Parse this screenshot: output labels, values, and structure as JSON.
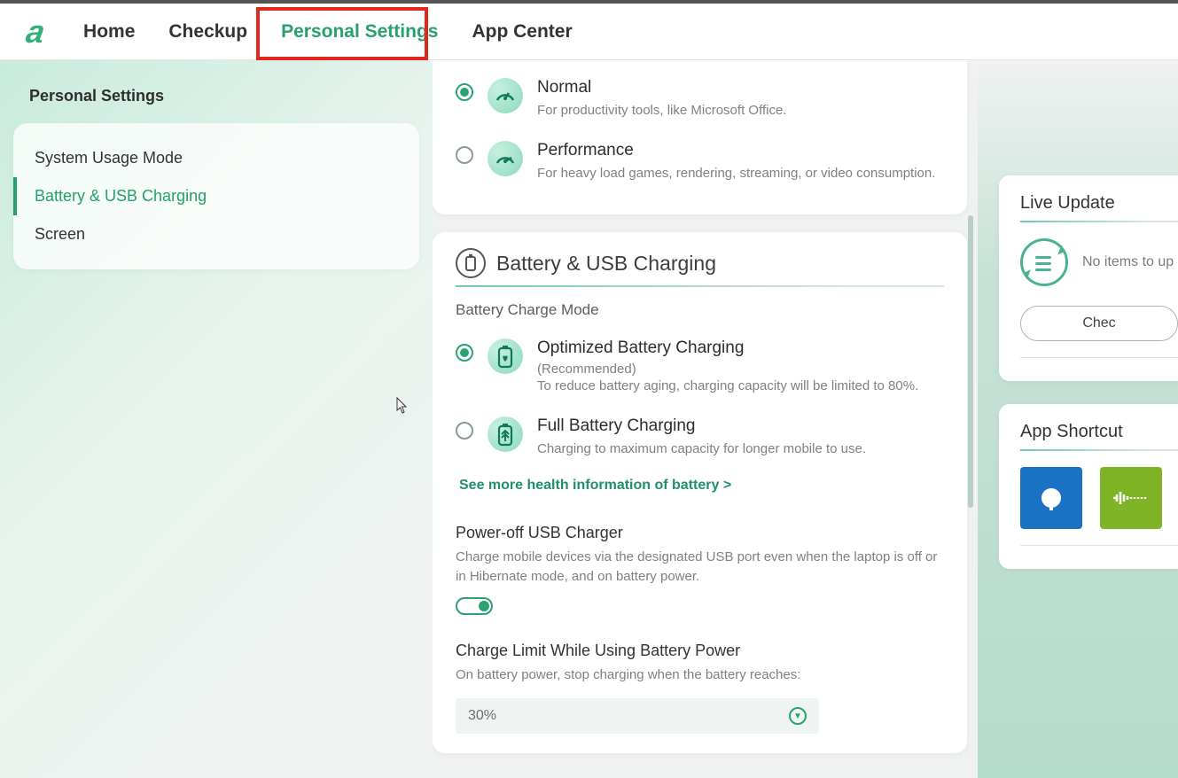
{
  "nav": {
    "items": [
      "Home",
      "Checkup",
      "Personal Settings",
      "App Center"
    ],
    "active_index": 2
  },
  "sidebar": {
    "heading": "Personal Settings",
    "items": [
      "System Usage Mode",
      "Battery & USB Charging",
      "Screen"
    ],
    "active_index": 1
  },
  "usage_mode": {
    "options": [
      {
        "title": "Normal",
        "desc": "For productivity tools, like Microsoft Office.",
        "selected": true
      },
      {
        "title": "Performance",
        "desc": "For heavy load games, rendering, streaming, or video consumption.",
        "selected": false
      }
    ]
  },
  "battery": {
    "section_title": "Battery & USB Charging",
    "charge_mode_label": "Battery Charge Mode",
    "options": [
      {
        "title": "Optimized Battery Charging",
        "rec": "(Recommended)",
        "desc": "To reduce battery aging, charging capacity will be limited to 80%.",
        "selected": true
      },
      {
        "title": "Full Battery Charging",
        "desc": "Charging to maximum capacity for longer mobile to use.",
        "selected": false
      }
    ],
    "more_link": "See more health information of battery >",
    "poweroff": {
      "title": "Power-off USB Charger",
      "desc": "Charge mobile devices via the designated USB port even when the laptop is off or in Hibernate mode, and on battery power.",
      "enabled": true
    },
    "charge_limit": {
      "title": "Charge Limit While Using Battery Power",
      "desc": "On battery power, stop charging when the battery reaches:",
      "value": "30%"
    }
  },
  "live_update": {
    "title": "Live Update",
    "status": "No items to up",
    "button": "Chec"
  },
  "app_shortcut": {
    "title": "App Shortcut"
  }
}
